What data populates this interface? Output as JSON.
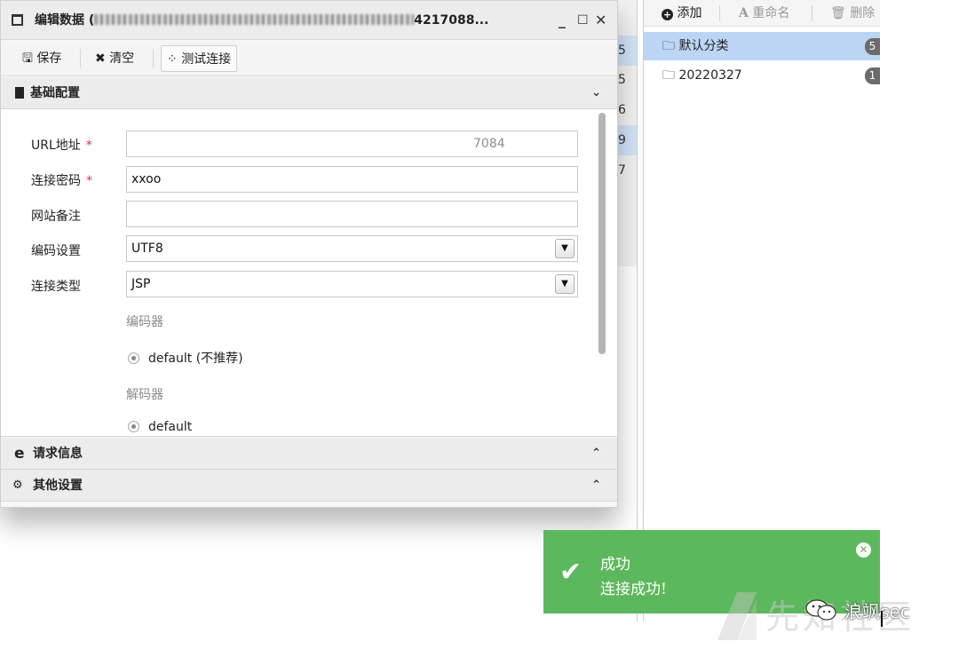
{
  "background_list": {
    "rows": [
      "5",
      "5",
      "6",
      "9",
      "7"
    ]
  },
  "category_panel": {
    "toolbar": {
      "add_label": "添加",
      "rename_label": "重命名",
      "delete_label": "删除"
    },
    "categories": [
      {
        "name": "默认分类",
        "count": "5"
      },
      {
        "name": "20220327",
        "count": "1"
      }
    ]
  },
  "dialog": {
    "title": "编辑数据 (",
    "title_suffix": "4217088...",
    "toolbar": {
      "save_label": "保存",
      "clear_label": "清空",
      "test_label": "测试连接"
    },
    "sections": {
      "basic": "基础配置",
      "request": "请求信息",
      "other": "其他设置"
    },
    "form": {
      "url_label": "URL地址",
      "url_value": "7084",
      "password_label": "连接密码",
      "password_value": "xxoo",
      "note_label": "网站备注",
      "note_value": "",
      "encoding_label": "编码设置",
      "encoding_value": "UTF8",
      "type_label": "连接类型",
      "type_value": "JSP",
      "encoder_label": "编码器",
      "encoder_option": "default (不推荐)",
      "decoder_label": "解码器",
      "decoder_option": "default"
    }
  },
  "toast": {
    "title": "成功",
    "message": "连接成功!"
  },
  "watermark": {
    "wechat_text": "浪飒sec",
    "site_text": "先知社区"
  },
  "colors": {
    "toast_bg": "#5cb85c",
    "selected_category": "#bcd5f4",
    "required_star": "#e03131"
  }
}
